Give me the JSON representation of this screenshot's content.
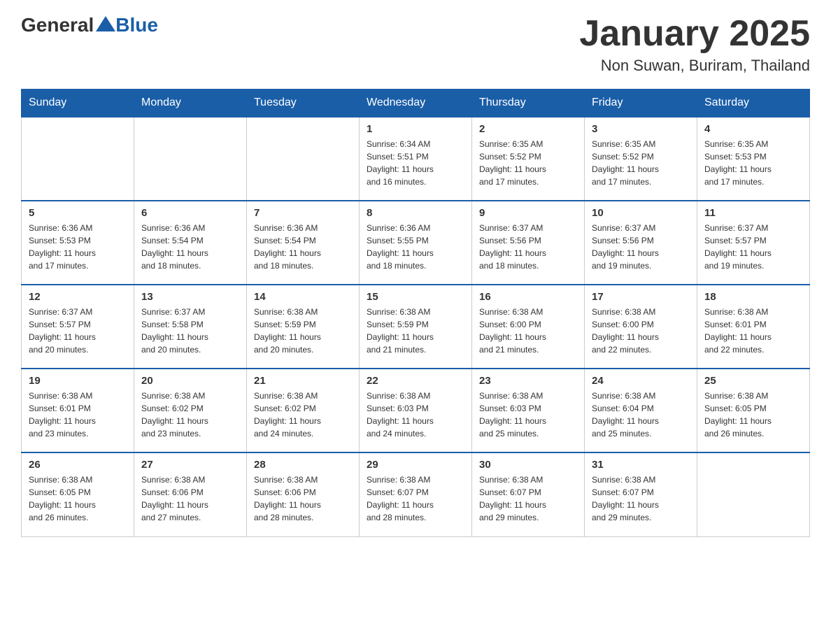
{
  "header": {
    "logo_general": "General",
    "logo_blue": "Blue",
    "title": "January 2025",
    "subtitle": "Non Suwan, Buriram, Thailand"
  },
  "columns": [
    "Sunday",
    "Monday",
    "Tuesday",
    "Wednesday",
    "Thursday",
    "Friday",
    "Saturday"
  ],
  "weeks": [
    [
      {
        "day": "",
        "info": ""
      },
      {
        "day": "",
        "info": ""
      },
      {
        "day": "",
        "info": ""
      },
      {
        "day": "1",
        "info": "Sunrise: 6:34 AM\nSunset: 5:51 PM\nDaylight: 11 hours\nand 16 minutes."
      },
      {
        "day": "2",
        "info": "Sunrise: 6:35 AM\nSunset: 5:52 PM\nDaylight: 11 hours\nand 17 minutes."
      },
      {
        "day": "3",
        "info": "Sunrise: 6:35 AM\nSunset: 5:52 PM\nDaylight: 11 hours\nand 17 minutes."
      },
      {
        "day": "4",
        "info": "Sunrise: 6:35 AM\nSunset: 5:53 PM\nDaylight: 11 hours\nand 17 minutes."
      }
    ],
    [
      {
        "day": "5",
        "info": "Sunrise: 6:36 AM\nSunset: 5:53 PM\nDaylight: 11 hours\nand 17 minutes."
      },
      {
        "day": "6",
        "info": "Sunrise: 6:36 AM\nSunset: 5:54 PM\nDaylight: 11 hours\nand 18 minutes."
      },
      {
        "day": "7",
        "info": "Sunrise: 6:36 AM\nSunset: 5:54 PM\nDaylight: 11 hours\nand 18 minutes."
      },
      {
        "day": "8",
        "info": "Sunrise: 6:36 AM\nSunset: 5:55 PM\nDaylight: 11 hours\nand 18 minutes."
      },
      {
        "day": "9",
        "info": "Sunrise: 6:37 AM\nSunset: 5:56 PM\nDaylight: 11 hours\nand 18 minutes."
      },
      {
        "day": "10",
        "info": "Sunrise: 6:37 AM\nSunset: 5:56 PM\nDaylight: 11 hours\nand 19 minutes."
      },
      {
        "day": "11",
        "info": "Sunrise: 6:37 AM\nSunset: 5:57 PM\nDaylight: 11 hours\nand 19 minutes."
      }
    ],
    [
      {
        "day": "12",
        "info": "Sunrise: 6:37 AM\nSunset: 5:57 PM\nDaylight: 11 hours\nand 20 minutes."
      },
      {
        "day": "13",
        "info": "Sunrise: 6:37 AM\nSunset: 5:58 PM\nDaylight: 11 hours\nand 20 minutes."
      },
      {
        "day": "14",
        "info": "Sunrise: 6:38 AM\nSunset: 5:59 PM\nDaylight: 11 hours\nand 20 minutes."
      },
      {
        "day": "15",
        "info": "Sunrise: 6:38 AM\nSunset: 5:59 PM\nDaylight: 11 hours\nand 21 minutes."
      },
      {
        "day": "16",
        "info": "Sunrise: 6:38 AM\nSunset: 6:00 PM\nDaylight: 11 hours\nand 21 minutes."
      },
      {
        "day": "17",
        "info": "Sunrise: 6:38 AM\nSunset: 6:00 PM\nDaylight: 11 hours\nand 22 minutes."
      },
      {
        "day": "18",
        "info": "Sunrise: 6:38 AM\nSunset: 6:01 PM\nDaylight: 11 hours\nand 22 minutes."
      }
    ],
    [
      {
        "day": "19",
        "info": "Sunrise: 6:38 AM\nSunset: 6:01 PM\nDaylight: 11 hours\nand 23 minutes."
      },
      {
        "day": "20",
        "info": "Sunrise: 6:38 AM\nSunset: 6:02 PM\nDaylight: 11 hours\nand 23 minutes."
      },
      {
        "day": "21",
        "info": "Sunrise: 6:38 AM\nSunset: 6:02 PM\nDaylight: 11 hours\nand 24 minutes."
      },
      {
        "day": "22",
        "info": "Sunrise: 6:38 AM\nSunset: 6:03 PM\nDaylight: 11 hours\nand 24 minutes."
      },
      {
        "day": "23",
        "info": "Sunrise: 6:38 AM\nSunset: 6:03 PM\nDaylight: 11 hours\nand 25 minutes."
      },
      {
        "day": "24",
        "info": "Sunrise: 6:38 AM\nSunset: 6:04 PM\nDaylight: 11 hours\nand 25 minutes."
      },
      {
        "day": "25",
        "info": "Sunrise: 6:38 AM\nSunset: 6:05 PM\nDaylight: 11 hours\nand 26 minutes."
      }
    ],
    [
      {
        "day": "26",
        "info": "Sunrise: 6:38 AM\nSunset: 6:05 PM\nDaylight: 11 hours\nand 26 minutes."
      },
      {
        "day": "27",
        "info": "Sunrise: 6:38 AM\nSunset: 6:06 PM\nDaylight: 11 hours\nand 27 minutes."
      },
      {
        "day": "28",
        "info": "Sunrise: 6:38 AM\nSunset: 6:06 PM\nDaylight: 11 hours\nand 28 minutes."
      },
      {
        "day": "29",
        "info": "Sunrise: 6:38 AM\nSunset: 6:07 PM\nDaylight: 11 hours\nand 28 minutes."
      },
      {
        "day": "30",
        "info": "Sunrise: 6:38 AM\nSunset: 6:07 PM\nDaylight: 11 hours\nand 29 minutes."
      },
      {
        "day": "31",
        "info": "Sunrise: 6:38 AM\nSunset: 6:07 PM\nDaylight: 11 hours\nand 29 minutes."
      },
      {
        "day": "",
        "info": ""
      }
    ]
  ]
}
